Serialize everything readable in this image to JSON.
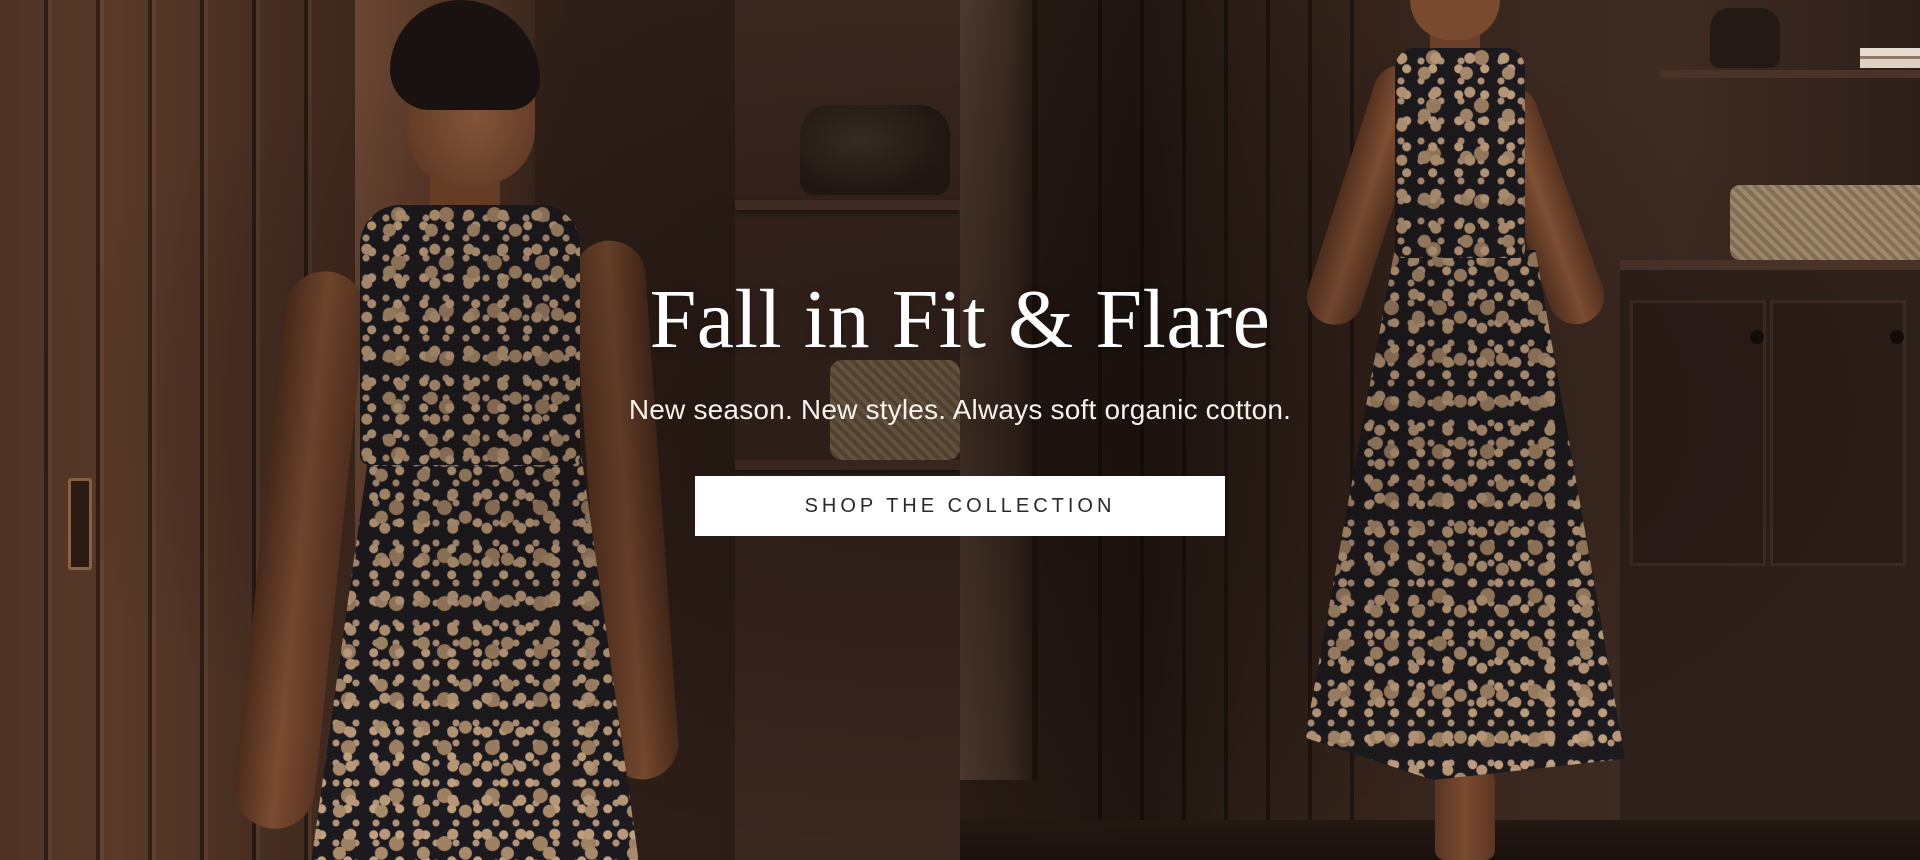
{
  "hero": {
    "headline": "Fall in Fit & Flare",
    "subheadline": "New season. New styles. Always soft organic cotton.",
    "cta_label": "SHOP THE COLLECTION"
  },
  "colors": {
    "cta_background": "#ffffff",
    "cta_text": "#2a2a2a",
    "headline_text": "#ffffff",
    "background_wood": "#2b1d17"
  },
  "images": {
    "left": "model-in-floral-fit-and-flare-dress-looking-left",
    "right": "model-in-floral-fit-and-flare-dress-hands-on-hips"
  }
}
